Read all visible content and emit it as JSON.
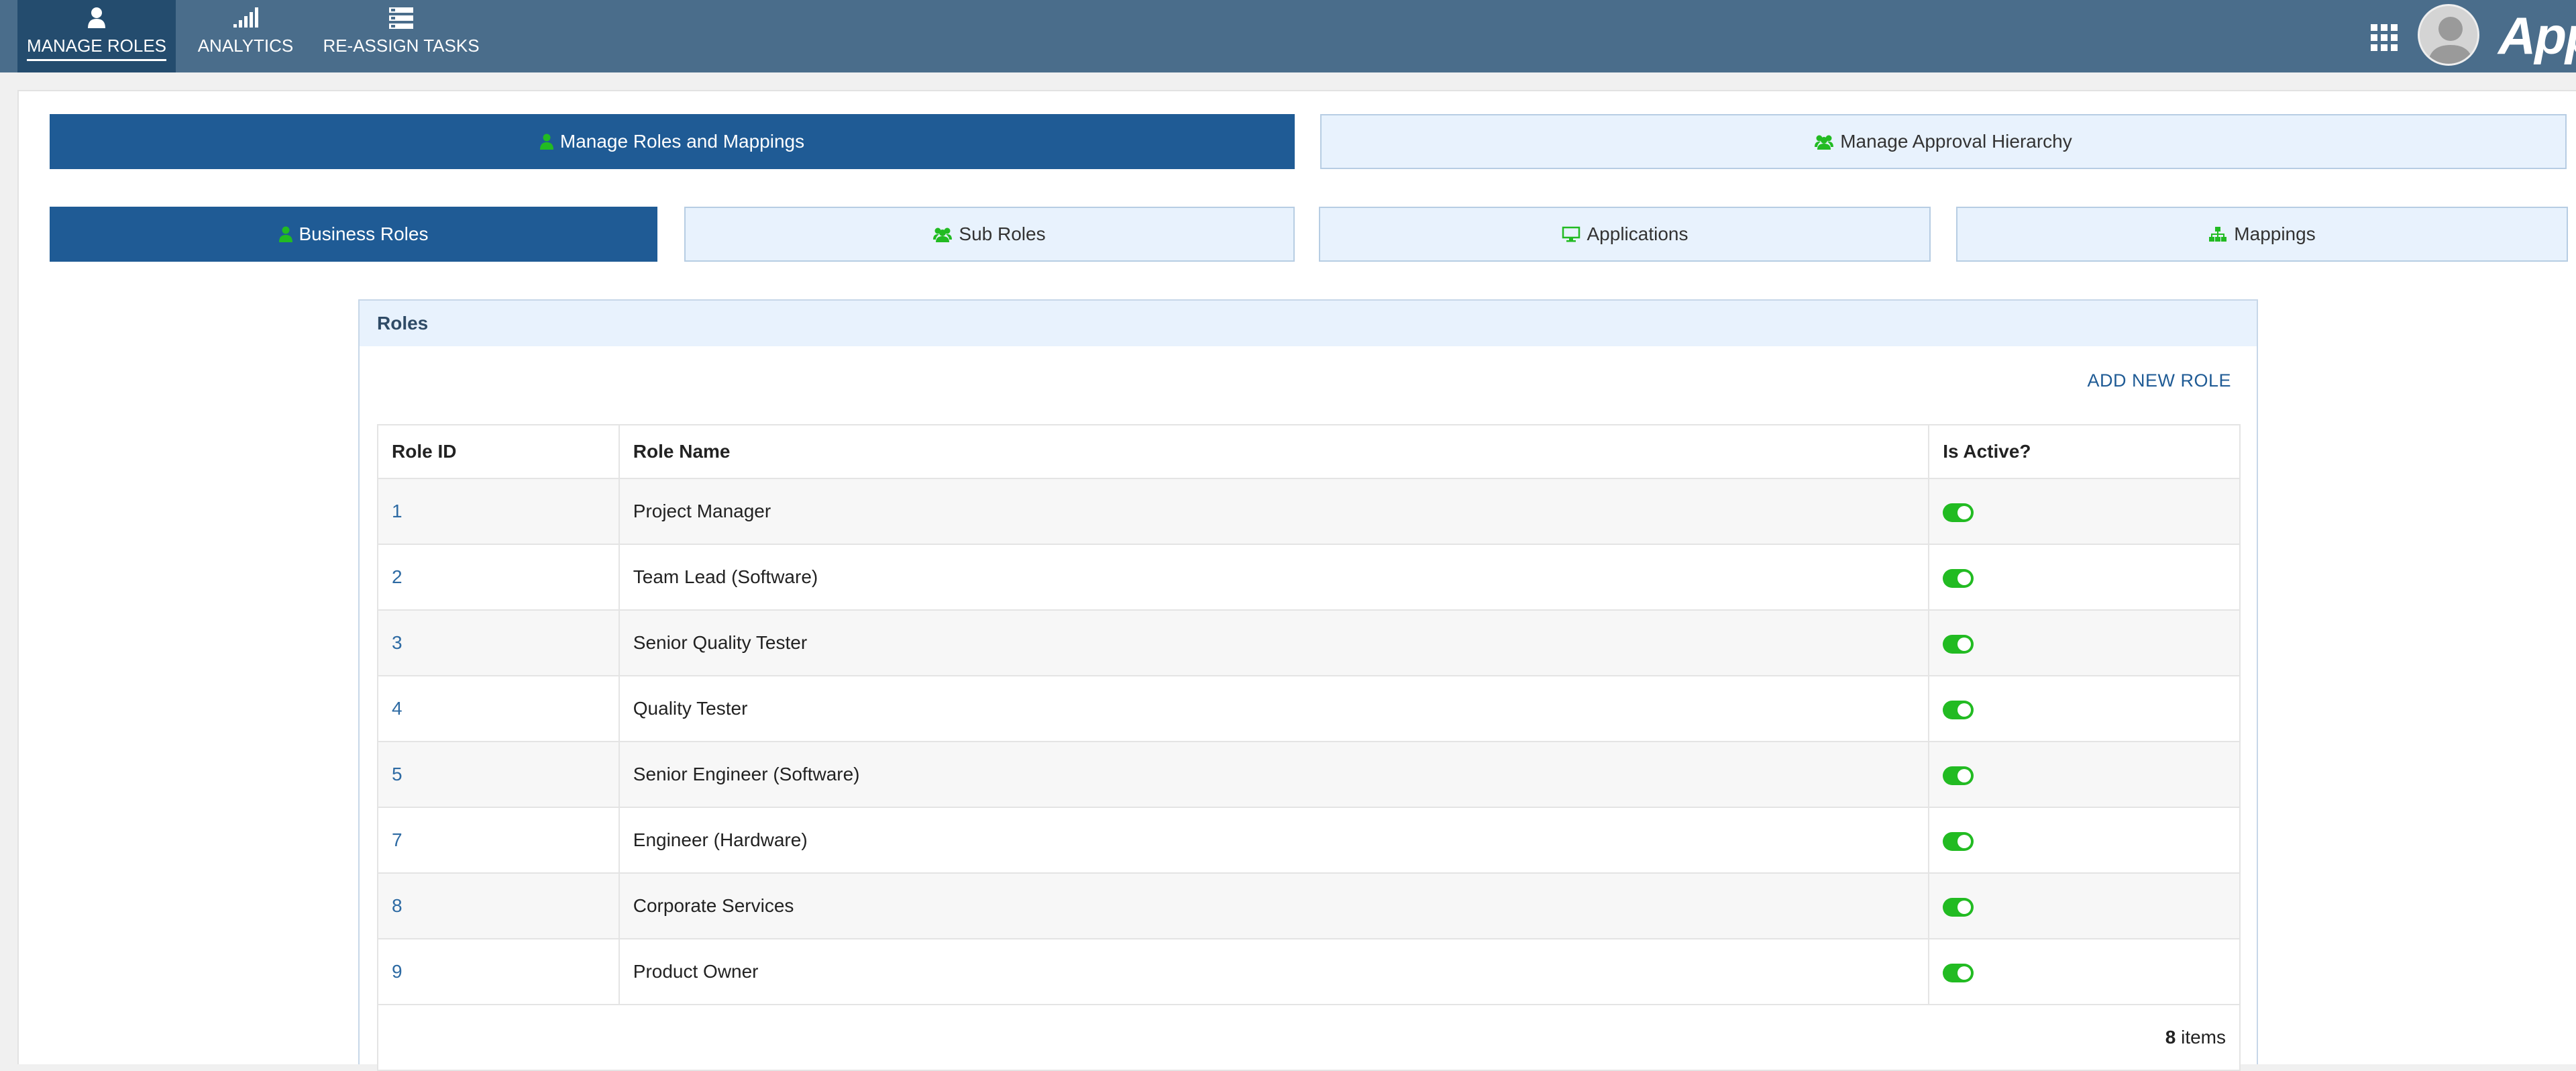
{
  "topnav": {
    "items": [
      {
        "label": "MANAGE ROLES",
        "icon": "person-icon",
        "active": true
      },
      {
        "label": "ANALYTICS",
        "icon": "signal-bars-icon",
        "active": false
      },
      {
        "label": "RE-ASSIGN TASKS",
        "icon": "tasks-list-icon",
        "active": false
      }
    ],
    "brand": "Appian"
  },
  "main_tabs": [
    {
      "label": "Manage Roles and Mappings",
      "icon": "person-icon",
      "active": true
    },
    {
      "label": "Manage Approval Hierarchy",
      "icon": "group-icon",
      "active": false
    }
  ],
  "sub_tabs": [
    {
      "label": "Business Roles",
      "icon": "person-icon",
      "active": true
    },
    {
      "label": "Sub Roles",
      "icon": "group-icon",
      "active": false
    },
    {
      "label": "Applications",
      "icon": "monitor-icon",
      "active": false
    },
    {
      "label": "Mappings",
      "icon": "sitemap-icon",
      "active": false
    }
  ],
  "roles_section": {
    "title": "Roles",
    "add_label": "ADD NEW ROLE",
    "columns": [
      "Role ID",
      "Role Name",
      "Is Active?"
    ],
    "rows": [
      {
        "id": "1",
        "name": "Project Manager",
        "active": true
      },
      {
        "id": "2",
        "name": "Team Lead (Software)",
        "active": true
      },
      {
        "id": "3",
        "name": "Senior Quality Tester",
        "active": true
      },
      {
        "id": "4",
        "name": "Quality Tester",
        "active": true
      },
      {
        "id": "5",
        "name": "Senior Engineer (Software)",
        "active": true
      },
      {
        "id": "7",
        "name": "Engineer (Hardware)",
        "active": true
      },
      {
        "id": "8",
        "name": "Corporate Services",
        "active": true
      },
      {
        "id": "9",
        "name": "Product Owner",
        "active": true
      }
    ],
    "count": "8",
    "count_suffix": "items"
  },
  "colors": {
    "topbar": "#4a6d8b",
    "active_tab": "#1f5b95",
    "inactive_tab": "#e8f2fd",
    "icon_green": "#22bb22"
  }
}
